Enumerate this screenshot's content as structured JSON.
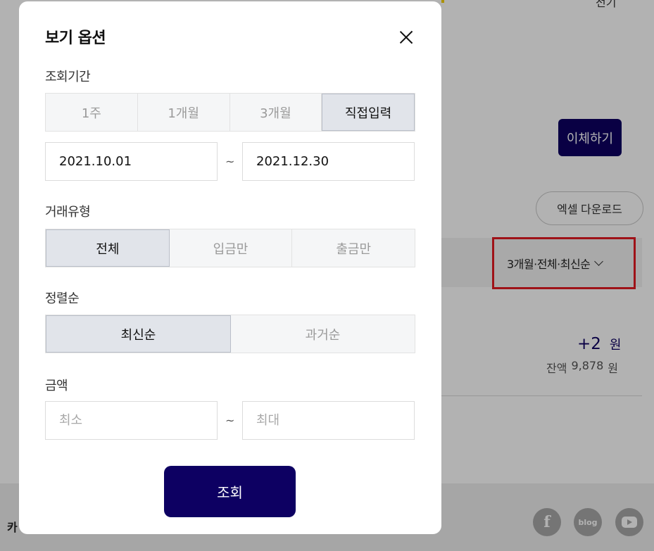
{
  "background": {
    "top_text": "전기",
    "transfer_button": "이체하기",
    "excel_button": "엑셀 다운로드",
    "filter_summary": "3개월·전체·최신순",
    "amount_value": "+2",
    "amount_unit": "원",
    "balance_label": "잔액",
    "balance_value": "9,878",
    "balance_unit": "원",
    "footer_left": "카",
    "social_facebook": "f",
    "social_blog": "blog",
    "social_youtube": "youtube-icon"
  },
  "modal": {
    "title": "보기 옵션",
    "period": {
      "label": "조회기간",
      "options": [
        "1주",
        "1개월",
        "3개월",
        "직접입력"
      ],
      "selected": "직접입력",
      "start_date": "2021.10.01",
      "end_date": "2021.12.30",
      "separator": "~"
    },
    "type": {
      "label": "거래유형",
      "options": [
        "전체",
        "입금만",
        "출금만"
      ],
      "selected": "전체"
    },
    "sort": {
      "label": "정렬순",
      "options": [
        "최신순",
        "과거순"
      ],
      "selected": "최신순"
    },
    "amount": {
      "label": "금액",
      "min_placeholder": "최소",
      "max_placeholder": "최대",
      "separator": "~"
    },
    "submit_label": "조회"
  },
  "colors": {
    "brand_navy": "#0d0062",
    "highlight_red": "#e41b23",
    "segment_active_bg": "#e1e4ea",
    "segment_bg": "#f5f6f7"
  }
}
